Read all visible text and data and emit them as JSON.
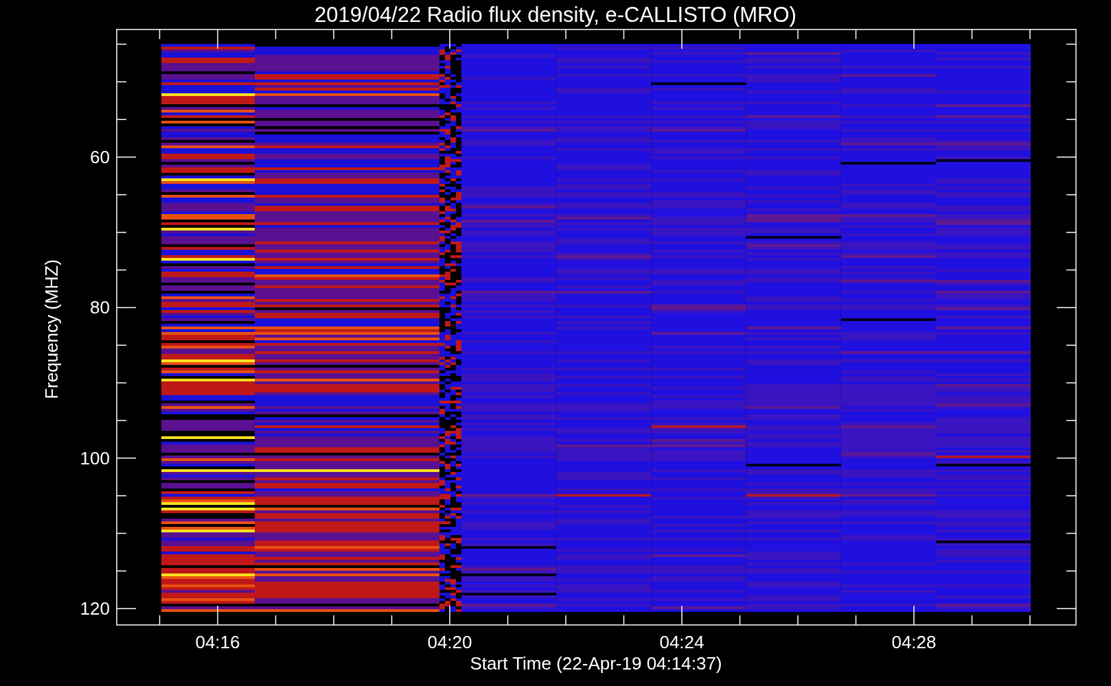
{
  "plot": {
    "title": "2019/04/22  Radio flux density, e-CALLISTO (MRO)",
    "x_axis": {
      "label": "Start Time (22-Apr-19 04:14:37)",
      "ticks": [
        "04:16",
        "04:20",
        "04:24",
        "04:28"
      ]
    },
    "y_axis": {
      "label": "Frequency (MHZ)",
      "ticks": [
        "60",
        "80",
        "100",
        "120"
      ]
    }
  }
}
